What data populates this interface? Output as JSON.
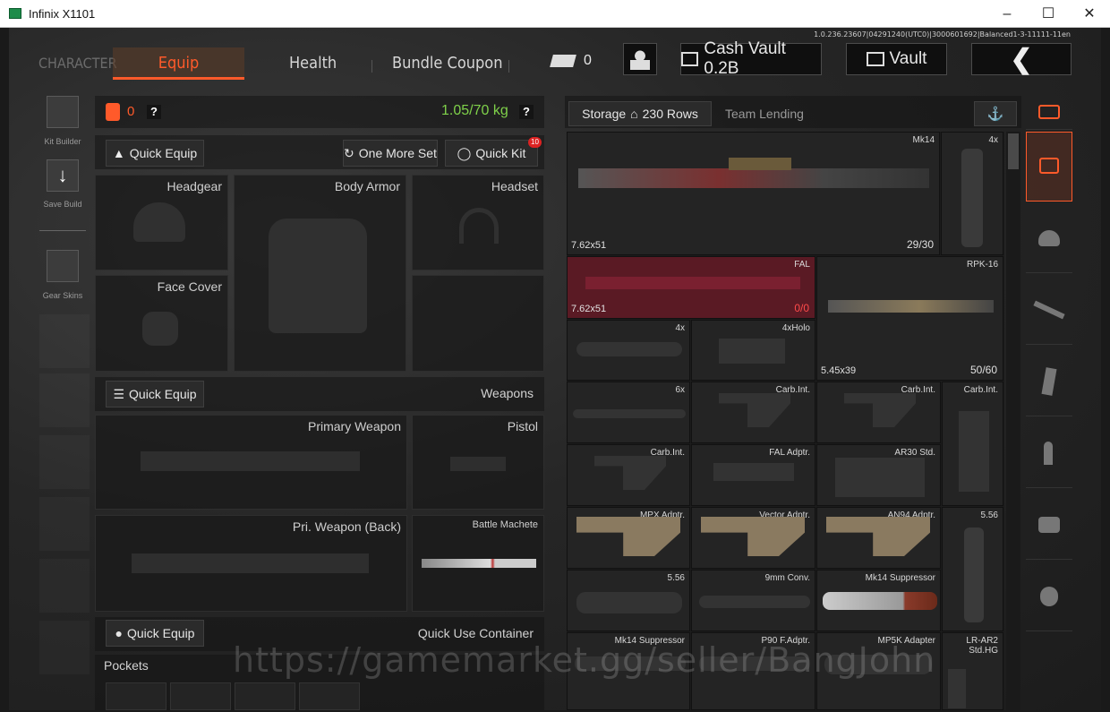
{
  "window": {
    "title": "Infinix X1101"
  },
  "version_info": "1.0.236.23607|04291240(UTC0)|3000601692|Balanced1-3-11111-11en",
  "tabs": {
    "character": "CHARACTER",
    "equip": "Equip",
    "health": "Health",
    "bundle": "Bundle Coupon"
  },
  "header": {
    "coupon_count": "0",
    "cash_vault": "Cash Vault 0.2B",
    "vault": "Vault"
  },
  "left_sidebar": {
    "kit_builder": "Kit Builder",
    "save_build": "Save Build",
    "gear_skins": "Gear Skins"
  },
  "loadout": {
    "backpack_count": "0",
    "weight": "1.05/70 kg",
    "quick_equip": "Quick Equip",
    "one_more_set": "One More Set",
    "quick_kit": "Quick Kit",
    "quick_kit_badge": "10",
    "slots": {
      "headgear": "Headgear",
      "body_armor": "Body Armor",
      "headset": "Headset",
      "face_cover": "Face Cover"
    },
    "weapons_title": "Weapons",
    "weapon_slots": {
      "primary": "Primary Weapon",
      "pistol": "Pistol",
      "primary_back": "Pri. Weapon (Back)",
      "melee": "Battle Machete"
    },
    "quick_use_title": "Quick Use Container",
    "pockets": "Pockets"
  },
  "storage": {
    "label": "Storage",
    "rows": "230 Rows",
    "team_lending": "Team Lending",
    "items": [
      {
        "name": "Mk14",
        "caliber": "7.62x51",
        "count": "29/30"
      },
      {
        "name": "4x"
      },
      {
        "name": "FAL",
        "caliber": "7.62x51",
        "count": "0/0"
      },
      {
        "name": "RPK-16",
        "caliber": "5.45x39",
        "count": "50/60"
      },
      {
        "name": "4x"
      },
      {
        "name": "4xHolo"
      },
      {
        "name": "6x"
      },
      {
        "name": "Carb.Int."
      },
      {
        "name": "Carb.Int."
      },
      {
        "name": "Carb.Int."
      },
      {
        "name": "Carb.Int."
      },
      {
        "name": "FAL Adptr."
      },
      {
        "name": "AR30 Std."
      },
      {
        "name": "MPX Adptr."
      },
      {
        "name": "Vector Adptr."
      },
      {
        "name": "AN94 Adptr."
      },
      {
        "name": "5.56"
      },
      {
        "name": "5.56"
      },
      {
        "name": "9mm Conv."
      },
      {
        "name": "Mk14 Suppressor"
      },
      {
        "name": "Mk14 Suppressor"
      },
      {
        "name": "P90 F.Adptr."
      },
      {
        "name": "MP5K Adapter"
      },
      {
        "name": "LR-AR2 Std.HG"
      }
    ]
  },
  "watermark": "https://gamemarket.gg/seller/BangJohn",
  "colors": {
    "accent": "#ff5a2a",
    "weight_green": "#7fd14a",
    "fal_bg": "#5a1a24"
  }
}
